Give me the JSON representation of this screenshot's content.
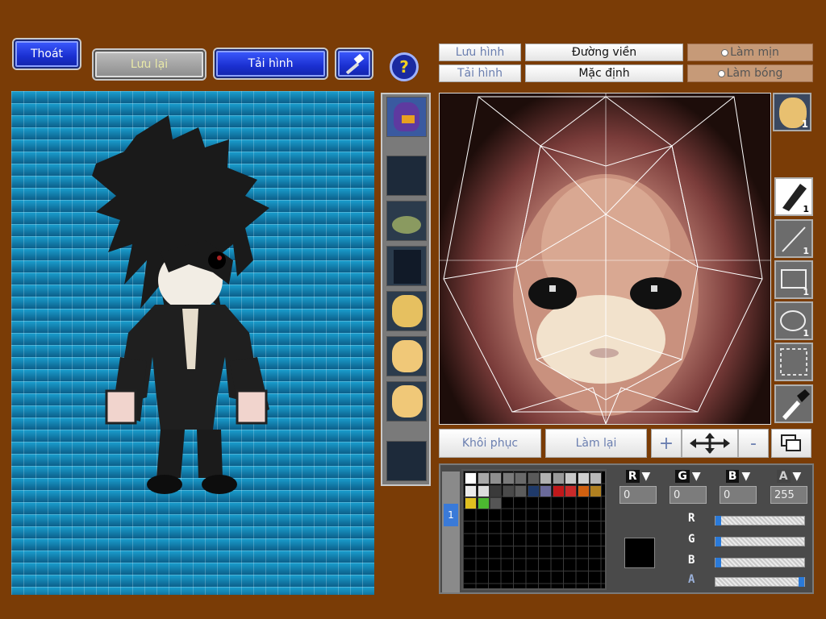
{
  "toolbar": {
    "exit_label": "Thoát",
    "save_label": "Lưu lại",
    "load_label": "Tải hình",
    "hammer_icon": "hammer-icon",
    "help_icon": "help-icon"
  },
  "editor": {
    "save_image_label": "Lưu hình",
    "load_image_label": "Tải hình",
    "outline_label": "Đường viền",
    "default_label": "Mặc định",
    "smooth_label": "Làm mịn",
    "shade_label": "Làm bóng",
    "restore_label": "Khôi phục",
    "redo_label": "Làm lại",
    "zoom_in_label": "+",
    "zoom_out_label": "-"
  },
  "tools": {
    "pen_count": "1",
    "line_count": "1",
    "rect_count": "1",
    "ellipse_count": "1",
    "face_badge": "1"
  },
  "color": {
    "r_label": "R",
    "g_label": "G",
    "b_label": "B",
    "a_label": "A",
    "r_value": "0",
    "g_value": "0",
    "b_value": "0",
    "a_value": "255",
    "r_level": 0,
    "g_level": 0,
    "b_level": 0,
    "a_level": 1.0,
    "current_color": "#000000",
    "palette_tab": "1"
  },
  "palette": {
    "row1": [
      "#ffffff",
      "#a8a8a8",
      "#8f8f8f",
      "#7a7a7a",
      "#6a6a6a",
      "#5a5a5a",
      "#b0b0b0",
      "#9a9a9a",
      "#c9c9c9",
      "#d0d0d0",
      "#b8b8b8"
    ],
    "row2": [
      "#ececec",
      "#dcdcdc",
      "#3a3a3a",
      "#4a4a4a",
      "#5c5c5c",
      "#1f3a6a",
      "#6a6a9a",
      "#c0181a",
      "#c82a2a",
      "#d06010",
      "#b08020"
    ],
    "row3": [
      "#e0c020",
      "#4cb830",
      "#555555"
    ]
  }
}
